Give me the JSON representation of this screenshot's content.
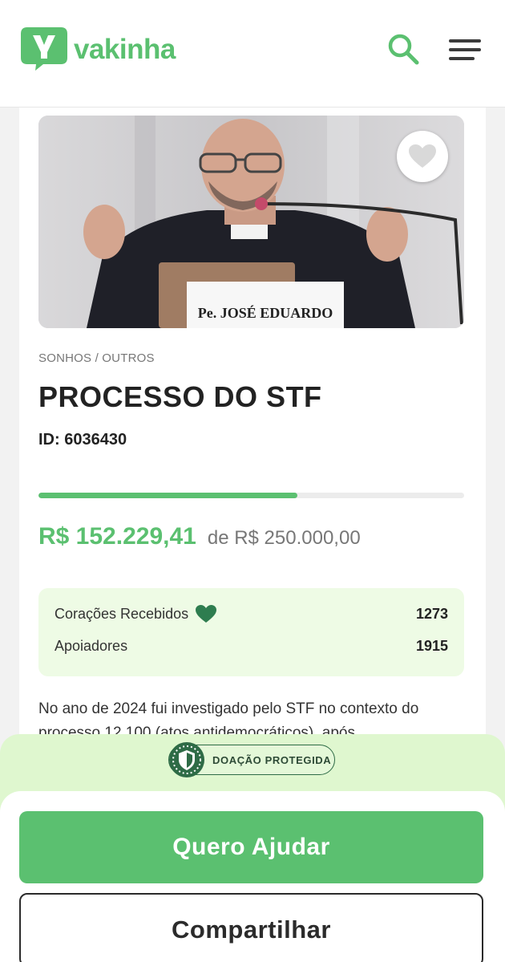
{
  "header": {
    "brand": "vakinha",
    "logo_letter": "V",
    "icons": {
      "search": "search-icon",
      "menu": "hamburger-menu-icon"
    }
  },
  "campaign": {
    "image": {
      "placard_text": "Pe. JOSÉ EDUARDO",
      "favorite_icon": "heart-icon"
    },
    "category": "SONHOS / OUTROS",
    "title": "PROCESSO DO STF",
    "id_label": "ID: 6036430",
    "progress_fraction": 0.609,
    "raised": "R$ 152.229,41",
    "goal": "de R$ 250.000,00",
    "stats": {
      "hearts_label": "Corações Recebidos",
      "hearts_value": "1273",
      "supporters_label": "Apoiadores",
      "supporters_value": "1915"
    },
    "description": "No ano de 2024 fui investigado pelo STF no contexto do processo 12.100 (atos antidemocráticos), após"
  },
  "bottom": {
    "badge": "DOAÇÃO PROTEGIDA",
    "help_button": "Quero Ajudar",
    "share_button": "Compartilhar"
  },
  "colors": {
    "brand_green": "#5bc070",
    "heart_green": "#2e7d4f",
    "stats_bg": "#eefbe5",
    "sheet_band": "#dff7cf"
  }
}
